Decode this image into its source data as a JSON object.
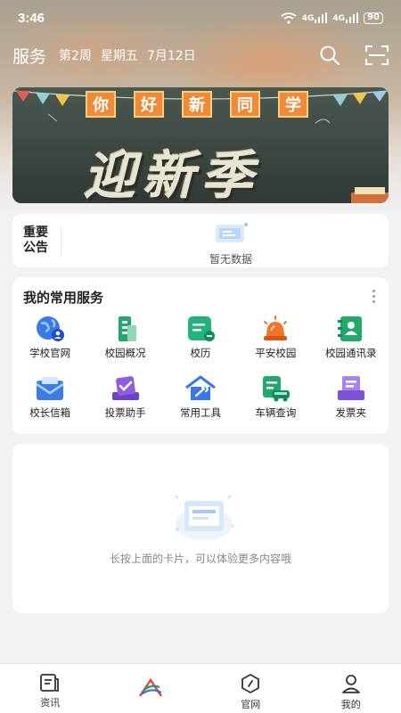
{
  "status": {
    "time": "3:46",
    "signal1": "4G",
    "signal2": "4G",
    "battery": "90"
  },
  "header": {
    "title": "服务",
    "week": "第2周",
    "weekday": "星期五",
    "date": "7月12日",
    "icons": [
      "search-icon",
      "scan-icon"
    ]
  },
  "banner": {
    "flag_chars": [
      "你",
      "好",
      "新",
      "同",
      "学"
    ],
    "headline": "迎新季"
  },
  "notice": {
    "label": "重要公告",
    "empty_text": "暂无数据"
  },
  "services": {
    "title": "我的常用服务",
    "items": [
      {
        "label": "学校官网",
        "icon": "globe-icon",
        "color": "#3b78e7"
      },
      {
        "label": "校园概况",
        "icon": "building-icon",
        "color": "#21a86a"
      },
      {
        "label": "校历",
        "icon": "calendar-icon",
        "color": "#1fb57a"
      },
      {
        "label": "平安校园",
        "icon": "alarm-icon",
        "color": "#f0742a"
      },
      {
        "label": "校园通讯录",
        "icon": "contacts-icon",
        "color": "#22a86d"
      },
      {
        "label": "校长信箱",
        "icon": "mail-icon",
        "color": "#3a7ee6"
      },
      {
        "label": "投票助手",
        "icon": "vote-icon",
        "color": "#8d5fe0"
      },
      {
        "label": "常用工具",
        "icon": "tools-icon",
        "color": "#3b78e7"
      },
      {
        "label": "车辆查询",
        "icon": "car-icon",
        "color": "#22a86d"
      },
      {
        "label": "发票夹",
        "icon": "invoice-icon",
        "color": "#8d5fe0"
      }
    ]
  },
  "empty_card": {
    "text": "长按上面的卡片，可以体验更多内容哦"
  },
  "nav": {
    "items": [
      {
        "label": "资讯",
        "icon": "news-icon"
      },
      {
        "label": "",
        "icon": "app-logo-icon"
      },
      {
        "label": "官网",
        "icon": "website-icon"
      },
      {
        "label": "我的",
        "icon": "profile-icon"
      }
    ]
  }
}
